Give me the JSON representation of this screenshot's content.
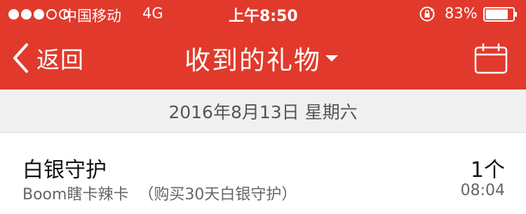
{
  "status_bar": {
    "carrier": "中国移动",
    "network": "4G",
    "time": "上午8:50",
    "battery_percent": "83%",
    "battery_level": 0.83
  },
  "nav": {
    "back_label": "返回",
    "title": "收到的礼物",
    "icons": [
      "chevron-left-icon",
      "caret-down-icon",
      "calendar-icon"
    ]
  },
  "date_header": "2016年8月13日 星期六",
  "gifts": [
    {
      "name": "白银守护",
      "description": "Boom瞎卡辣卡  （购买30天白银守护）",
      "count": "1个",
      "time": "08:04"
    }
  ],
  "colors": {
    "brand_red": "#e13a2c",
    "date_band": "#f0f0f0"
  }
}
